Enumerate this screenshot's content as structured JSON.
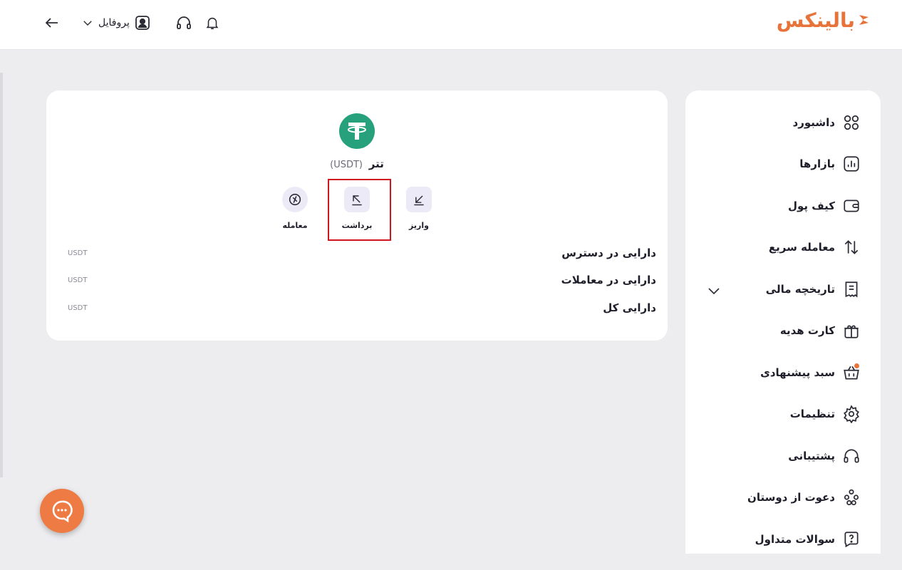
{
  "brand": {
    "logo_text": "بالینکس",
    "accent_color": "#e8733a"
  },
  "header": {
    "profile_label": "پروفایل",
    "icons": [
      "bell-icon",
      "headset-icon",
      "user-icon",
      "chevron-down-icon",
      "arrow-left-icon"
    ]
  },
  "asset": {
    "name": "تتر",
    "symbol": "(USDT)",
    "coin_color": "#26a17b",
    "actions": {
      "deposit": "واریز",
      "withdraw": "برداشت",
      "trade": "معامله"
    },
    "rows": [
      {
        "label": "دارایی در دسترس",
        "unit": "USDT"
      },
      {
        "label": "دارایی در معاملات",
        "unit": "USDT"
      },
      {
        "label": "دارایی کل",
        "unit": "USDT"
      }
    ]
  },
  "sidebar": {
    "items": [
      {
        "label": "داشبورد",
        "icon": "grid-icon"
      },
      {
        "label": "بازارها",
        "icon": "chart-icon"
      },
      {
        "label": "کیف پول",
        "icon": "wallet-icon"
      },
      {
        "label": "معامله سریع",
        "icon": "swap-icon"
      },
      {
        "label": "تاریخچه مالی",
        "icon": "receipt-icon"
      },
      {
        "label": "کارت هدیه",
        "icon": "gift-icon"
      },
      {
        "label": "سبد پیشنهادی",
        "icon": "basket-icon"
      },
      {
        "label": "تنظیمات",
        "icon": "gear-icon"
      },
      {
        "label": "پشتیبانی",
        "icon": "headset-icon"
      },
      {
        "label": "دعوت از دوستان",
        "icon": "people-icon"
      },
      {
        "label": "سوالات متداول",
        "icon": "question-icon"
      }
    ]
  }
}
